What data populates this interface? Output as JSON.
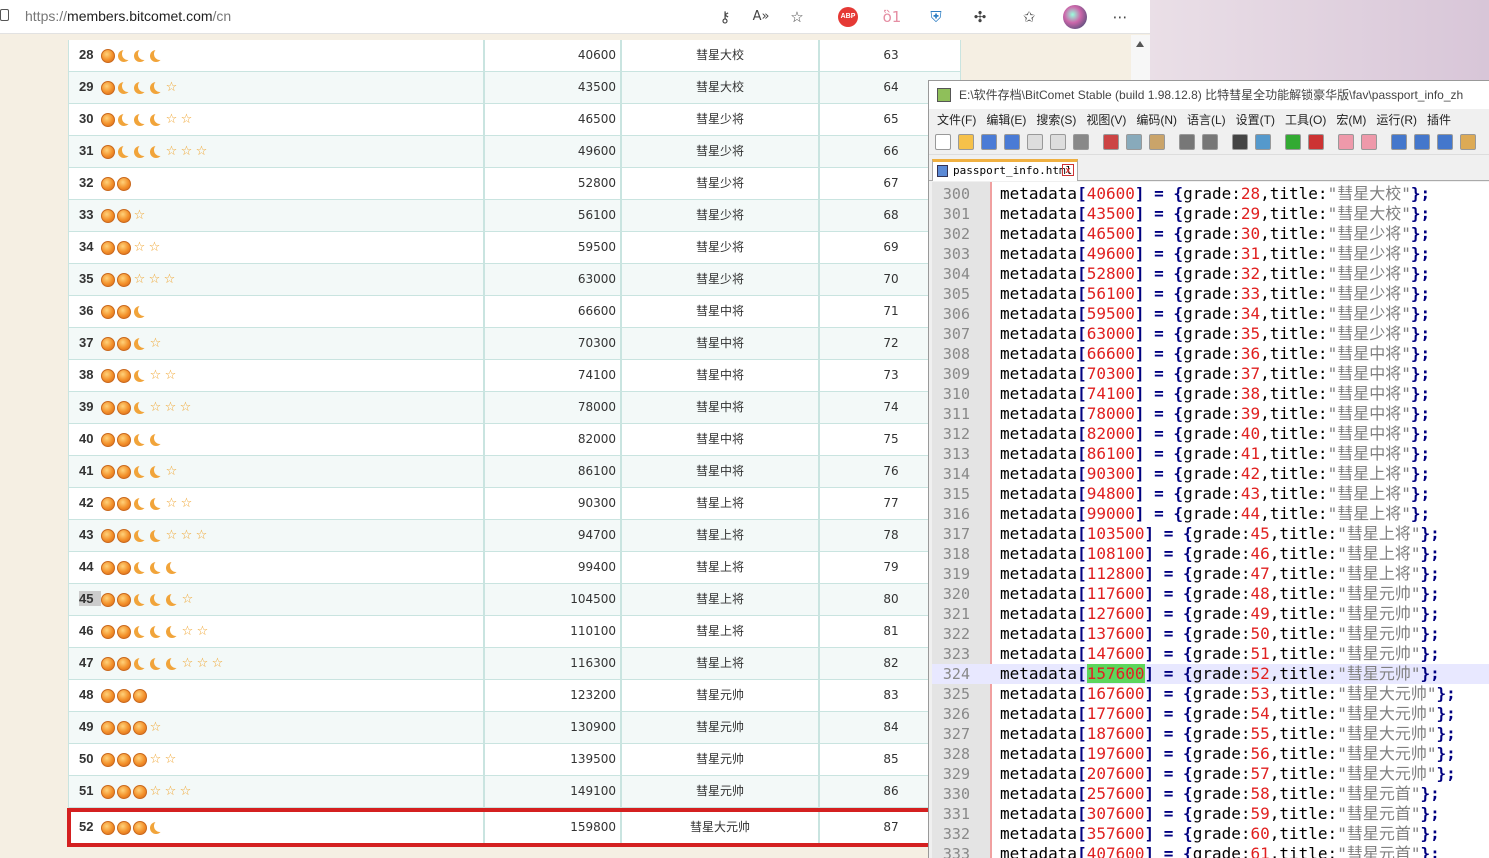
{
  "browser": {
    "url_prefix": "https://",
    "url_host": "members.bitcomet.com",
    "url_path": "/cn",
    "icons": [
      "key-icon",
      "read-aloud-icon",
      "add-favorite-icon",
      "adblock-icon",
      "extension-cat-icon",
      "extension-shield-icon",
      "extensions-icon",
      "favorites-icon",
      "profile-icon",
      "more-icon"
    ],
    "abp_label": "ABP"
  },
  "table": {
    "rows": [
      {
        "level": "28",
        "icons": [
          "sun",
          "moon",
          "moon",
          "moon"
        ],
        "points": "40600",
        "title": "彗星大校",
        "grade": "63"
      },
      {
        "level": "29",
        "icons": [
          "sun",
          "moon",
          "moon",
          "moon",
          "star"
        ],
        "points": "43500",
        "title": "彗星大校",
        "grade": "64"
      },
      {
        "level": "30",
        "icons": [
          "sun",
          "moon",
          "moon",
          "moon",
          "star",
          "star"
        ],
        "points": "46500",
        "title": "彗星少将",
        "grade": "65"
      },
      {
        "level": "31",
        "icons": [
          "sun",
          "moon",
          "moon",
          "moon",
          "star",
          "star",
          "star"
        ],
        "points": "49600",
        "title": "彗星少将",
        "grade": "66"
      },
      {
        "level": "32",
        "icons": [
          "sun",
          "sun"
        ],
        "points": "52800",
        "title": "彗星少将",
        "grade": "67"
      },
      {
        "level": "33",
        "icons": [
          "sun",
          "sun",
          "star"
        ],
        "points": "56100",
        "title": "彗星少将",
        "grade": "68"
      },
      {
        "level": "34",
        "icons": [
          "sun",
          "sun",
          "star",
          "star"
        ],
        "points": "59500",
        "title": "彗星少将",
        "grade": "69"
      },
      {
        "level": "35",
        "icons": [
          "sun",
          "sun",
          "star",
          "star",
          "star"
        ],
        "points": "63000",
        "title": "彗星少将",
        "grade": "70"
      },
      {
        "level": "36",
        "icons": [
          "sun",
          "sun",
          "moon"
        ],
        "points": "66600",
        "title": "彗星中将",
        "grade": "71"
      },
      {
        "level": "37",
        "icons": [
          "sun",
          "sun",
          "moon",
          "star"
        ],
        "points": "70300",
        "title": "彗星中将",
        "grade": "72"
      },
      {
        "level": "38",
        "icons": [
          "sun",
          "sun",
          "moon",
          "star",
          "star"
        ],
        "points": "74100",
        "title": "彗星中将",
        "grade": "73"
      },
      {
        "level": "39",
        "icons": [
          "sun",
          "sun",
          "moon",
          "star",
          "star",
          "star"
        ],
        "points": "78000",
        "title": "彗星中将",
        "grade": "74"
      },
      {
        "level": "40",
        "icons": [
          "sun",
          "sun",
          "moon",
          "moon"
        ],
        "points": "82000",
        "title": "彗星中将",
        "grade": "75"
      },
      {
        "level": "41",
        "icons": [
          "sun",
          "sun",
          "moon",
          "moon",
          "star"
        ],
        "points": "86100",
        "title": "彗星中将",
        "grade": "76"
      },
      {
        "level": "42",
        "icons": [
          "sun",
          "sun",
          "moon",
          "moon",
          "star",
          "star"
        ],
        "points": "90300",
        "title": "彗星上将",
        "grade": "77"
      },
      {
        "level": "43",
        "icons": [
          "sun",
          "sun",
          "moon",
          "moon",
          "star",
          "star",
          "star"
        ],
        "points": "94700",
        "title": "彗星上将",
        "grade": "78"
      },
      {
        "level": "44",
        "icons": [
          "sun",
          "sun",
          "moon",
          "moon",
          "moon"
        ],
        "points": "99400",
        "title": "彗星上将",
        "grade": "79"
      },
      {
        "level": "45",
        "icons": [
          "sun",
          "sun",
          "moon",
          "moon",
          "moon",
          "star"
        ],
        "points": "104500",
        "title": "彗星上将",
        "grade": "80",
        "highlight": true
      },
      {
        "level": "46",
        "icons": [
          "sun",
          "sun",
          "moon",
          "moon",
          "moon",
          "star",
          "star"
        ],
        "points": "110100",
        "title": "彗星上将",
        "grade": "81"
      },
      {
        "level": "47",
        "icons": [
          "sun",
          "sun",
          "moon",
          "moon",
          "moon",
          "star",
          "star",
          "star"
        ],
        "points": "116300",
        "title": "彗星上将",
        "grade": "82"
      },
      {
        "level": "48",
        "icons": [
          "sun",
          "sun",
          "sun"
        ],
        "points": "123200",
        "title": "彗星元帅",
        "grade": "83"
      },
      {
        "level": "49",
        "icons": [
          "sun",
          "sun",
          "sun",
          "star"
        ],
        "points": "130900",
        "title": "彗星元帅",
        "grade": "84"
      },
      {
        "level": "50",
        "icons": [
          "sun",
          "sun",
          "sun",
          "star",
          "star"
        ],
        "points": "139500",
        "title": "彗星元帅",
        "grade": "85"
      },
      {
        "level": "51",
        "icons": [
          "sun",
          "sun",
          "sun",
          "star",
          "star",
          "star"
        ],
        "points": "149100",
        "title": "彗星元帅",
        "grade": "86"
      },
      {
        "level": "52",
        "icons": [
          "sun",
          "sun",
          "sun",
          "moon"
        ],
        "points": "159800",
        "title": "彗星大元帅",
        "grade": "87"
      }
    ]
  },
  "npp": {
    "title": "E:\\软件存档\\BitComet Stable (build 1.98.12.8) 比特彗星全功能解锁豪华版\\fav\\passport_info_zh",
    "menu": [
      "文件(F)",
      "编辑(E)",
      "搜索(S)",
      "视图(V)",
      "编码(N)",
      "语言(L)",
      "设置(T)",
      "工具(O)",
      "宏(M)",
      "运行(R)",
      "插件"
    ],
    "tab": "passport_info.html",
    "tab_close": "x",
    "current_line": "324",
    "lines": [
      {
        "n": "300",
        "key": "40600",
        "grade": "28",
        "title": "彗星大校"
      },
      {
        "n": "301",
        "key": "43500",
        "grade": "29",
        "title": "彗星大校"
      },
      {
        "n": "302",
        "key": "46500",
        "grade": "30",
        "title": "彗星少将"
      },
      {
        "n": "303",
        "key": "49600",
        "grade": "31",
        "title": "彗星少将"
      },
      {
        "n": "304",
        "key": "52800",
        "grade": "32",
        "title": "彗星少将"
      },
      {
        "n": "305",
        "key": "56100",
        "grade": "33",
        "title": "彗星少将"
      },
      {
        "n": "306",
        "key": "59500",
        "grade": "34",
        "title": "彗星少将"
      },
      {
        "n": "307",
        "key": "63000",
        "grade": "35",
        "title": "彗星少将"
      },
      {
        "n": "308",
        "key": "66600",
        "grade": "36",
        "title": "彗星中将"
      },
      {
        "n": "309",
        "key": "70300",
        "grade": "37",
        "title": "彗星中将"
      },
      {
        "n": "310",
        "key": "74100",
        "grade": "38",
        "title": "彗星中将"
      },
      {
        "n": "311",
        "key": "78000",
        "grade": "39",
        "title": "彗星中将"
      },
      {
        "n": "312",
        "key": "82000",
        "grade": "40",
        "title": "彗星中将"
      },
      {
        "n": "313",
        "key": "86100",
        "grade": "41",
        "title": "彗星中将"
      },
      {
        "n": "314",
        "key": "90300",
        "grade": "42",
        "title": "彗星上将"
      },
      {
        "n": "315",
        "key": "94800",
        "grade": "43",
        "title": "彗星上将"
      },
      {
        "n": "316",
        "key": "99000",
        "grade": "44",
        "title": "彗星上将"
      },
      {
        "n": "317",
        "key": "103500",
        "grade": "45",
        "title": "彗星上将"
      },
      {
        "n": "318",
        "key": "108100",
        "grade": "46",
        "title": "彗星上将"
      },
      {
        "n": "319",
        "key": "112800",
        "grade": "47",
        "title": "彗星上将"
      },
      {
        "n": "320",
        "key": "117600",
        "grade": "48",
        "title": "彗星元帅"
      },
      {
        "n": "321",
        "key": "127600",
        "grade": "49",
        "title": "彗星元帅"
      },
      {
        "n": "322",
        "key": "137600",
        "grade": "50",
        "title": "彗星元帅"
      },
      {
        "n": "323",
        "key": "147600",
        "grade": "51",
        "title": "彗星元帅"
      },
      {
        "n": "324",
        "key": "157600",
        "grade": "52",
        "title": "彗星元帅",
        "highlight": true
      },
      {
        "n": "325",
        "key": "167600",
        "grade": "53",
        "title": "彗星大元帅"
      },
      {
        "n": "326",
        "key": "177600",
        "grade": "54",
        "title": "彗星大元帅"
      },
      {
        "n": "327",
        "key": "187600",
        "grade": "55",
        "title": "彗星大元帅"
      },
      {
        "n": "328",
        "key": "197600",
        "grade": "56",
        "title": "彗星大元帅"
      },
      {
        "n": "329",
        "key": "207600",
        "grade": "57",
        "title": "彗星大元帅"
      },
      {
        "n": "330",
        "key": "257600",
        "grade": "58",
        "title": "彗星元首"
      },
      {
        "n": "331",
        "key": "307600",
        "grade": "59",
        "title": "彗星元首"
      },
      {
        "n": "332",
        "key": "357600",
        "grade": "60",
        "title": "彗星元首"
      },
      {
        "n": "333",
        "key": "407600",
        "grade": "61",
        "title": "彗星元首"
      }
    ]
  }
}
